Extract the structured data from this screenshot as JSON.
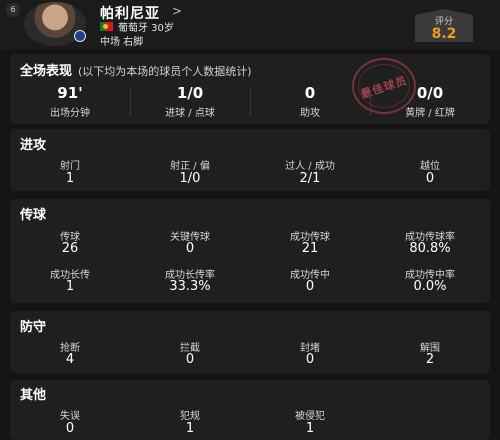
{
  "player": {
    "jersey_number": "6",
    "name": "帕利尼亚",
    "arrow": ">",
    "nationality_age": "葡萄牙 30岁",
    "position_foot": "中场   右脚",
    "flag_colors": [
      "#0a7b2e",
      "#d71a1a",
      "#f5c400"
    ]
  },
  "rating": {
    "label": "评分",
    "value": "8.2",
    "color": "#f39a1f"
  },
  "summary": {
    "title": "全场表现",
    "subtitle": "(以下均为本场的球员个人数据统计)",
    "stamp": "最佳球员",
    "stats": [
      {
        "value": "91'",
        "label": "出场分钟"
      },
      {
        "value": "1/0",
        "label": "进球 / 点球"
      },
      {
        "value": "0",
        "label": "助攻"
      },
      {
        "value": "0/0",
        "label": "黄牌 / 红牌"
      }
    ]
  },
  "attack": {
    "title": "进攻",
    "stats": [
      {
        "label": "射门",
        "value": "1"
      },
      {
        "label": "射正 / 偏",
        "value": "1/0"
      },
      {
        "label": "过人 / 成功",
        "value": "2/1"
      },
      {
        "label": "越位",
        "value": "0"
      }
    ]
  },
  "passing": {
    "title": "传球",
    "stats": [
      {
        "label": "传球",
        "value": "26"
      },
      {
        "label": "关键传球",
        "value": "0"
      },
      {
        "label": "成功传球",
        "value": "21"
      },
      {
        "label": "成功传球率",
        "value": "80.8%"
      },
      {
        "label": "成功长传",
        "value": "1"
      },
      {
        "label": "成功长传率",
        "value": "33.3%"
      },
      {
        "label": "成功传中",
        "value": "0"
      },
      {
        "label": "成功传中率",
        "value": "0.0%"
      }
    ]
  },
  "defense": {
    "title": "防守",
    "stats": [
      {
        "label": "抢断",
        "value": "4"
      },
      {
        "label": "拦截",
        "value": "0"
      },
      {
        "label": "封堵",
        "value": "0"
      },
      {
        "label": "解围",
        "value": "2"
      }
    ]
  },
  "other": {
    "title": "其他",
    "stats": [
      {
        "label": "失误",
        "value": "0"
      },
      {
        "label": "犯规",
        "value": "1"
      },
      {
        "label": "被侵犯",
        "value": "1"
      }
    ]
  }
}
